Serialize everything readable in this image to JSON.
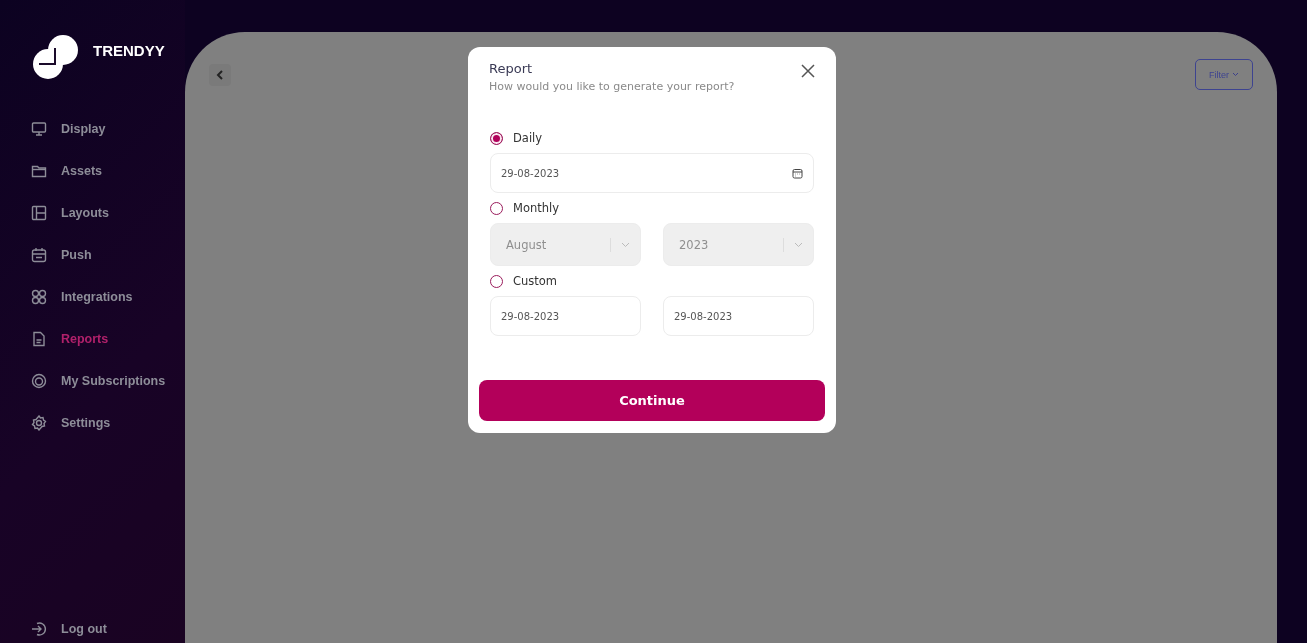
{
  "brand": {
    "name": "TRENDYY"
  },
  "sidebar": {
    "items": [
      {
        "label": "Display",
        "selected": false
      },
      {
        "label": "Assets",
        "selected": false
      },
      {
        "label": "Layouts",
        "selected": false
      },
      {
        "label": "Push",
        "selected": false
      },
      {
        "label": "Integrations",
        "selected": false
      },
      {
        "label": "Reports",
        "selected": true
      },
      {
        "label": "My Subscriptions",
        "selected": false
      },
      {
        "label": "Settings",
        "selected": false
      }
    ],
    "logout": "Log out"
  },
  "toolbar": {
    "filter": "Filter"
  },
  "dialog": {
    "title": "Report",
    "subtitle": "How would you like to generate your report?",
    "options": [
      {
        "label": "Daily",
        "selected": true,
        "kind": "date",
        "fields": [
          {
            "value": "29-08-2023",
            "disabled": false
          }
        ]
      },
      {
        "label": "Monthly",
        "selected": false,
        "kind": "select",
        "fields": [
          {
            "value": "August",
            "disabled": true
          },
          {
            "value": "2023",
            "disabled": true
          }
        ]
      },
      {
        "label": "Custom",
        "selected": false,
        "kind": "range",
        "fields": [
          {
            "value": "29-08-2023",
            "disabled": false
          },
          {
            "value": "29-08-2023",
            "disabled": false
          }
        ]
      }
    ],
    "button": "Continue"
  }
}
